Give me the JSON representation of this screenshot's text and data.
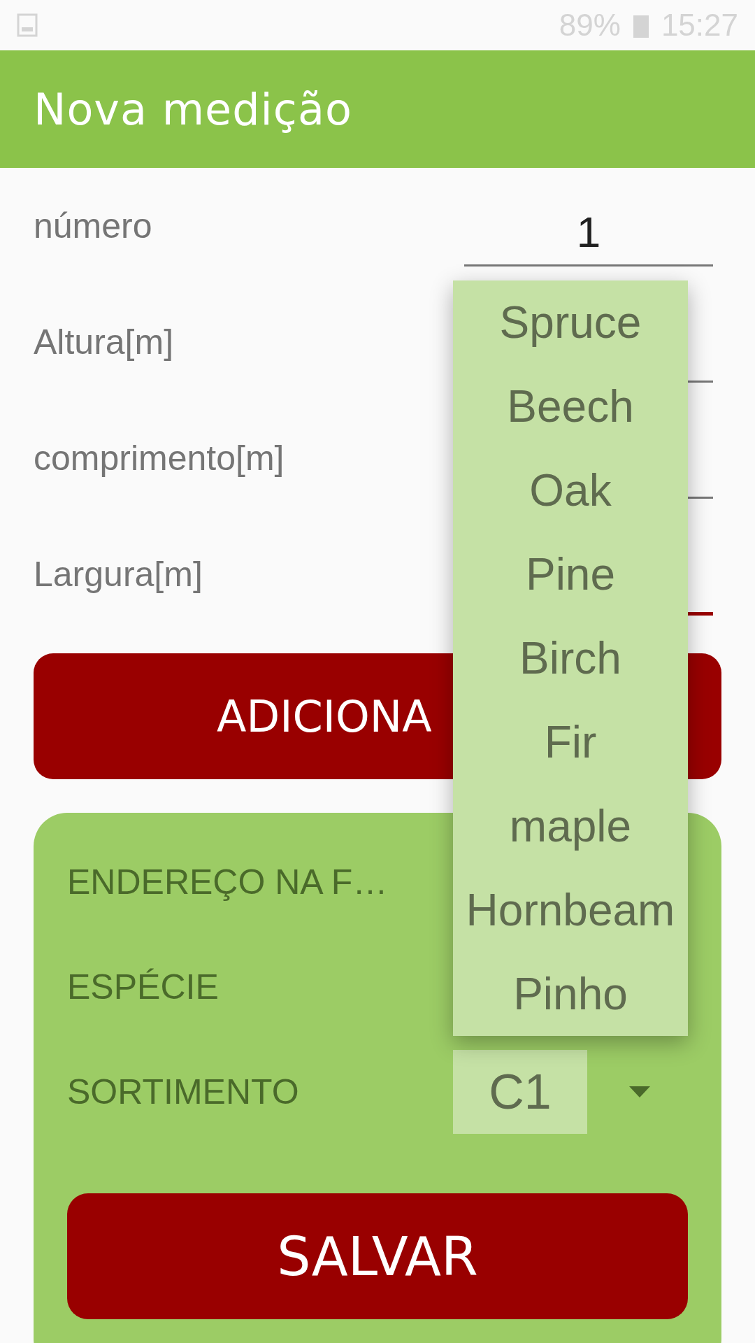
{
  "status_bar": {
    "battery": "89%",
    "time": "15:27"
  },
  "app_bar": {
    "title": "Nova medição"
  },
  "fields": [
    {
      "label": "número",
      "value": "1",
      "focused": false
    },
    {
      "label": "Altura[m]",
      "focused": false
    },
    {
      "label": "comprimento[m]",
      "focused": false
    },
    {
      "label": "Largura[m]",
      "focused": true
    }
  ],
  "add_button": {
    "label": "ADICIONA"
  },
  "card": {
    "rows": [
      {
        "label": "ENDEREÇO NA F…"
      },
      {
        "label": "ESPÉCIE"
      },
      {
        "label": "SORTIMENTO",
        "spinner": "C1"
      }
    ]
  },
  "save_button": {
    "label": "SALVAR"
  },
  "dropdown": {
    "options": [
      "Spruce",
      "Beech",
      "Oak",
      "Pine",
      "Birch",
      "Fir",
      "maple",
      "Hornbeam",
      "Pinho"
    ]
  }
}
